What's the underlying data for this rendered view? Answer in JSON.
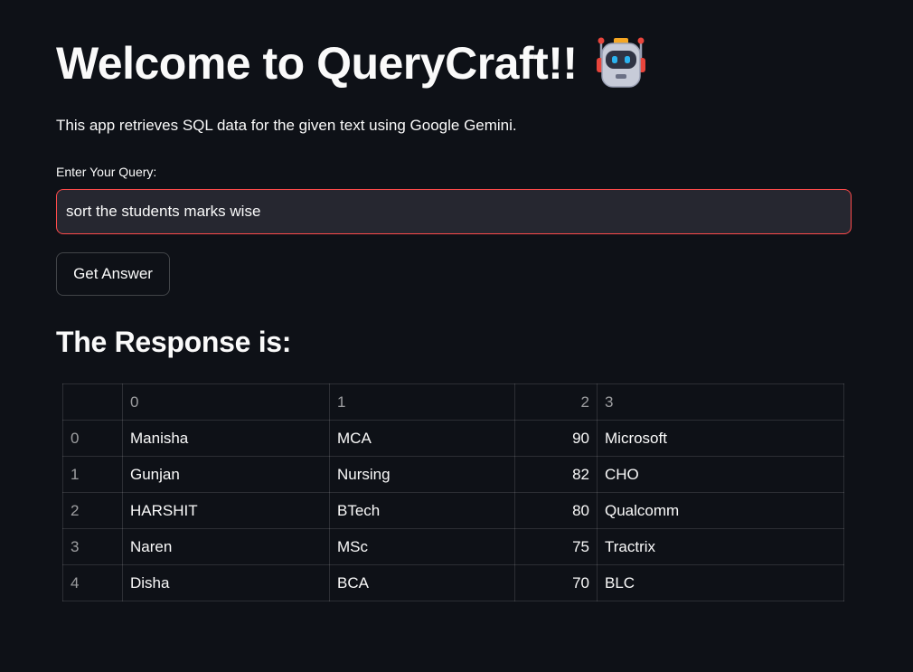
{
  "header": {
    "title": "Welcome to QueryCraft!!",
    "title_icon": "robot-emoji-icon",
    "subtitle": "This app retrieves SQL data for the given text using Google Gemini."
  },
  "query": {
    "label": "Enter Your Query:",
    "value": "sort the students marks wise"
  },
  "actions": {
    "submit_label": "Get Answer"
  },
  "response": {
    "heading": "The Response is:",
    "columns": [
      "",
      "0",
      "1",
      "2",
      "3"
    ],
    "rows": [
      {
        "index": "0",
        "c0": "Manisha",
        "c1": "MCA",
        "c2": "90",
        "c3": "Microsoft"
      },
      {
        "index": "1",
        "c0": "Gunjan",
        "c1": "Nursing",
        "c2": "82",
        "c3": "CHO"
      },
      {
        "index": "2",
        "c0": "HARSHIT",
        "c1": "BTech",
        "c2": "80",
        "c3": "Qualcomm"
      },
      {
        "index": "3",
        "c0": "Naren",
        "c1": "MSc",
        "c2": "75",
        "c3": "Tractrix"
      },
      {
        "index": "4",
        "c0": "Disha",
        "c1": "BCA",
        "c2": "70",
        "c3": "BLC"
      }
    ]
  },
  "colors": {
    "background": "#0e1117",
    "input_background": "#262730",
    "input_focus_border": "#ff4b4b",
    "text": "#fafafa"
  }
}
